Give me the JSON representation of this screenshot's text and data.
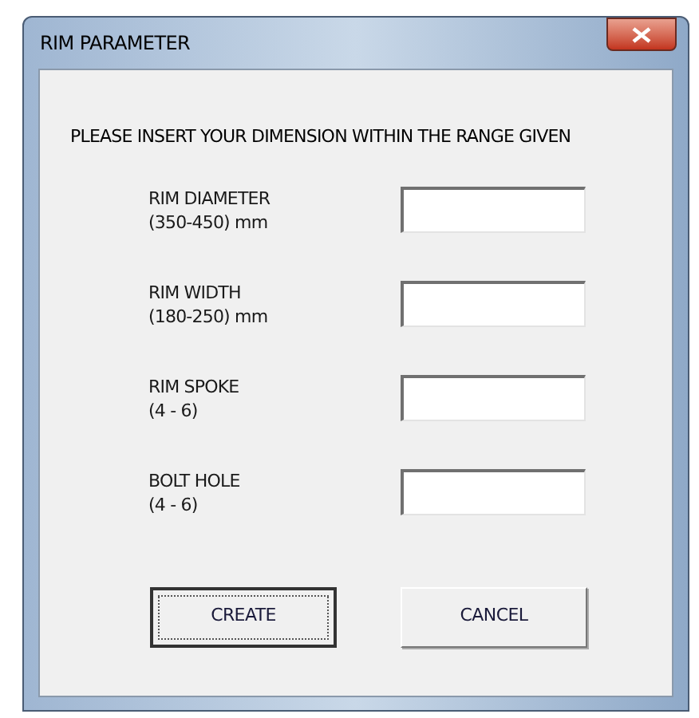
{
  "window": {
    "title": "RIM PARAMETER"
  },
  "instruction": "PLEASE INSERT YOUR DIMENSION WITHIN THE RANGE GIVEN",
  "fields": [
    {
      "label": "RIM DIAMETER",
      "range": "(350-450) mm"
    },
    {
      "label": "RIM WIDTH",
      "range": "(180-250) mm"
    },
    {
      "label": "RIM SPOKE",
      "range": "(4 - 6)"
    },
    {
      "label": "BOLT HOLE",
      "range": "(4 - 6)"
    }
  ],
  "buttons": [
    {
      "label": "CREATE",
      "focused": true
    },
    {
      "label": "CANCEL",
      "focused": false
    }
  ]
}
